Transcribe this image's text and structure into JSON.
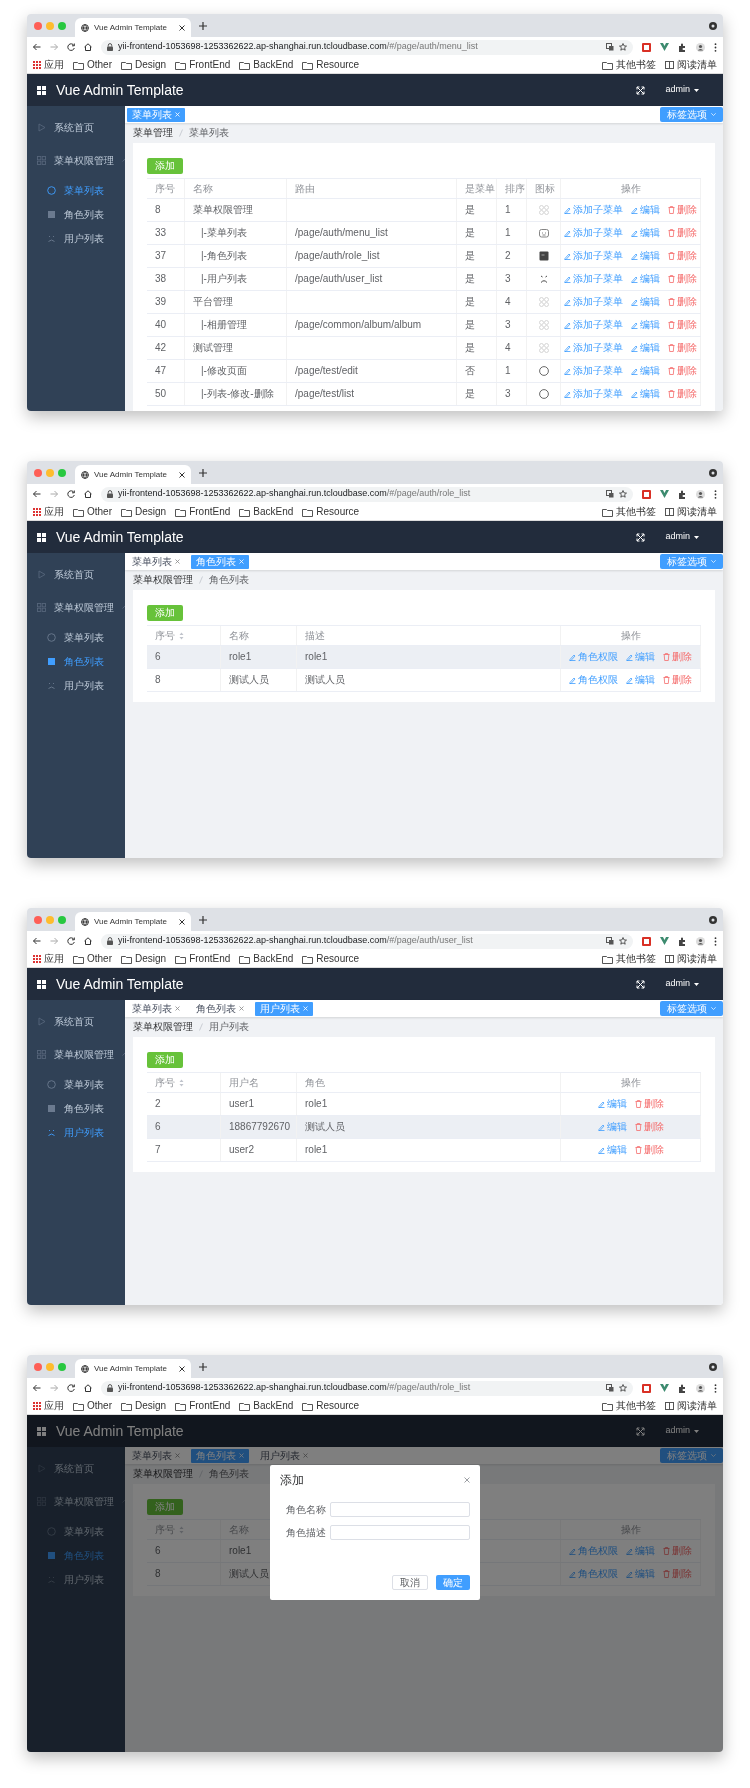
{
  "windows": [
    {
      "tab_title": "Vue Admin Template",
      "url_host": "yii-frontend-1053698-1253362622.ap-shanghai.run.tcloudbase.com",
      "url_path": "/#/page/auth/menu_list",
      "bookmarks": [
        "应用",
        "Other",
        "Design",
        "FrontEnd",
        "BackEnd",
        "Resource"
      ],
      "bookmarks_right": [
        "其他书签",
        "阅读清单"
      ],
      "app_title": "Vue Admin Template",
      "user": "admin",
      "sidebar": [
        {
          "label": "系统首页",
          "selected": false
        },
        {
          "label": "菜单权限管理",
          "expanded": true,
          "children": [
            {
              "label": "菜单列表",
              "selected": true
            },
            {
              "label": "角色列表",
              "selected": false
            },
            {
              "label": "用户列表",
              "selected": false
            }
          ]
        }
      ],
      "tags": [
        {
          "label": "菜单列表",
          "selected": true
        }
      ],
      "tags_menu": "标签选项",
      "breadcrumb": [
        "菜单管理",
        "菜单列表"
      ],
      "add_button": "添加",
      "table": {
        "kind": "menu",
        "columns": [
          {
            "label": "序号"
          },
          {
            "label": "名称"
          },
          {
            "label": "路由"
          },
          {
            "label": "是菜单"
          },
          {
            "label": "排序"
          },
          {
            "label": "图标"
          },
          {
            "label": "操作"
          }
        ],
        "rows": [
          {
            "id": "8",
            "name": "菜单权限管理",
            "is_menu": "是",
            "sort": "1",
            "actions": [
              {
                "label": "添加子菜单",
                "kind": "edit"
              },
              {
                "label": "编辑",
                "kind": "edit"
              },
              {
                "label": "删除",
                "kind": "delete"
              }
            ],
            "children": [
              {
                "id": "33",
                "name": "|-菜单列表",
                "route": "/page/auth/menu_list",
                "is_menu": "是",
                "sort": "1",
                "actions": [
                  {
                    "label": "添加子菜单",
                    "kind": "edit"
                  },
                  {
                    "label": "编辑",
                    "kind": "edit"
                  },
                  {
                    "label": "删除",
                    "kind": "delete"
                  }
                ]
              },
              {
                "id": "37",
                "name": "|-角色列表",
                "route": "/page/auth/role_list",
                "is_menu": "是",
                "sort": "2",
                "actions": [
                  {
                    "label": "添加子菜单",
                    "kind": "edit"
                  },
                  {
                    "label": "编辑",
                    "kind": "edit"
                  },
                  {
                    "label": "删除",
                    "kind": "delete"
                  }
                ]
              },
              {
                "id": "38",
                "name": "|-用户列表",
                "route": "/page/auth/user_list",
                "is_menu": "是",
                "sort": "3",
                "actions": [
                  {
                    "label": "添加子菜单",
                    "kind": "edit"
                  },
                  {
                    "label": "编辑",
                    "kind": "edit"
                  },
                  {
                    "label": "删除",
                    "kind": "delete"
                  }
                ]
              }
            ]
          },
          {
            "id": "39",
            "name": "平台管理",
            "is_menu": "是",
            "sort": "4",
            "actions": [
              {
                "label": "添加子菜单",
                "kind": "edit"
              },
              {
                "label": "编辑",
                "kind": "edit"
              },
              {
                "label": "删除",
                "kind": "delete"
              }
            ],
            "children": [
              {
                "id": "40",
                "name": "|-相册管理",
                "route": "/page/common/album/album",
                "is_menu": "是",
                "sort": "3",
                "actions": [
                  {
                    "label": "添加子菜单",
                    "kind": "edit"
                  },
                  {
                    "label": "编辑",
                    "kind": "edit"
                  },
                  {
                    "label": "删除",
                    "kind": "delete"
                  }
                ]
              }
            ]
          },
          {
            "id": "42",
            "name": "测试管理",
            "is_menu": "是",
            "sort": "4",
            "actions": [
              {
                "label": "添加子菜单",
                "kind": "edit"
              },
              {
                "label": "编辑",
                "kind": "edit"
              },
              {
                "label": "删除",
                "kind": "delete"
              }
            ],
            "children": [
              {
                "id": "47",
                "name": "|-修改页面",
                "route": "/page/test/edit",
                "is_menu": "否",
                "sort": "1",
                "actions": [
                  {
                    "label": "添加子菜单",
                    "kind": "edit"
                  },
                  {
                    "label": "编辑",
                    "kind": "edit"
                  },
                  {
                    "label": "删除",
                    "kind": "delete"
                  }
                ]
              },
              {
                "id": "50",
                "name": "|-列表-修改-删除",
                "route": "/page/test/list",
                "is_menu": "是",
                "sort": "3",
                "actions": [
                  {
                    "label": "添加子菜单",
                    "kind": "edit"
                  },
                  {
                    "label": "编辑",
                    "kind": "edit"
                  },
                  {
                    "label": "删除",
                    "kind": "delete"
                  }
                ]
              }
            ]
          }
        ]
      }
    },
    {
      "tab_title": "Vue Admin Template",
      "url_host": "yii-frontend-1053698-1253362622.ap-shanghai.run.tcloudbase.com",
      "url_path": "/#/page/auth/role_list",
      "bookmarks": [
        "应用",
        "Other",
        "Design",
        "FrontEnd",
        "BackEnd",
        "Resource"
      ],
      "bookmarks_right": [
        "其他书签",
        "阅读清单"
      ],
      "app_title": "Vue Admin Template",
      "user": "admin",
      "sidebar": [
        {
          "label": "系统首页",
          "selected": false
        },
        {
          "label": "菜单权限管理",
          "expanded": true,
          "children": [
            {
              "label": "菜单列表",
              "selected": false
            },
            {
              "label": "角色列表",
              "selected": true
            },
            {
              "label": "用户列表",
              "selected": false
            }
          ]
        }
      ],
      "tags": [
        {
          "label": "菜单列表",
          "selected": false
        },
        {
          "label": "角色列表",
          "selected": true
        }
      ],
      "tags_menu": "标签选项",
      "breadcrumb": [
        "菜单权限管理",
        "角色列表"
      ],
      "add_button": "添加",
      "table": {
        "kind": "role",
        "columns": [
          {
            "label": "序号",
            "sortable": true
          },
          {
            "label": "名称",
            "sortable": false
          },
          {
            "label": "描述",
            "sortable": false
          },
          {
            "label": "操作",
            "sortable": false
          }
        ],
        "rows": [
          {
            "id": "6",
            "name": "role1",
            "description": "role1",
            "hovered": true,
            "actions": [
              {
                "label": "角色权限",
                "kind": "edit"
              },
              {
                "label": "编辑",
                "kind": "edit"
              },
              {
                "label": "删除",
                "kind": "delete"
              }
            ]
          },
          {
            "id": "8",
            "name": "测试人员",
            "description": "测试人员",
            "hovered": false,
            "actions": [
              {
                "label": "角色权限",
                "kind": "edit"
              },
              {
                "label": "编辑",
                "kind": "edit"
              },
              {
                "label": "删除",
                "kind": "delete"
              }
            ]
          }
        ]
      }
    },
    {
      "tab_title": "Vue Admin Template",
      "url_host": "yii-frontend-1053698-1253362622.ap-shanghai.run.tcloudbase.com",
      "url_path": "/#/page/auth/user_list",
      "bookmarks": [
        "应用",
        "Other",
        "Design",
        "FrontEnd",
        "BackEnd",
        "Resource"
      ],
      "bookmarks_right": [
        "其他书签",
        "阅读清单"
      ],
      "app_title": "Vue Admin Template",
      "user": "admin",
      "sidebar": [
        {
          "label": "系统首页",
          "selected": false
        },
        {
          "label": "菜单权限管理",
          "expanded": true,
          "children": [
            {
              "label": "菜单列表",
              "selected": false
            },
            {
              "label": "角色列表",
              "selected": false
            },
            {
              "label": "用户列表",
              "selected": true
            }
          ]
        }
      ],
      "tags": [
        {
          "label": "菜单列表",
          "selected": false
        },
        {
          "label": "角色列表",
          "selected": false
        },
        {
          "label": "用户列表",
          "selected": true
        }
      ],
      "tags_menu": "标签选项",
      "breadcrumb": [
        "菜单权限管理",
        "用户列表"
      ],
      "add_button": "添加",
      "table": {
        "kind": "user",
        "columns": [
          {
            "label": "序号",
            "sortable": true
          },
          {
            "label": "用户名",
            "sortable": false
          },
          {
            "label": "角色",
            "sortable": false
          },
          {
            "label": "操作",
            "sortable": false
          }
        ],
        "rows": [
          {
            "id": "2",
            "name": "user1",
            "role": "role1",
            "hovered": false,
            "actions": [
              {
                "label": "编辑",
                "kind": "edit"
              },
              {
                "label": "删除",
                "kind": "delete"
              }
            ]
          },
          {
            "id": "6",
            "name": "18867792670",
            "role": "测试人员",
            "hovered": true,
            "actions": [
              {
                "label": "编辑",
                "kind": "edit"
              },
              {
                "label": "删除",
                "kind": "delete"
              }
            ]
          },
          {
            "id": "7",
            "name": "user2",
            "role": "role1",
            "hovered": false,
            "actions": [
              {
                "label": "编辑",
                "kind": "edit"
              },
              {
                "label": "删除",
                "kind": "delete"
              }
            ]
          }
        ]
      }
    },
    {
      "tab_title": "Vue Admin Template",
      "url_host": "yii-frontend-1053698-1253362622.ap-shanghai.run.tcloudbase.com",
      "url_path": "/#/page/auth/role_list",
      "bookmarks": [
        "应用",
        "Other",
        "Design",
        "FrontEnd",
        "BackEnd",
        "Resource"
      ],
      "bookmarks_right": [
        "其他书签",
        "阅读清单"
      ],
      "app_title": "Vue Admin Template",
      "user": "admin",
      "sidebar": [
        {
          "label": "系统首页",
          "selected": false
        },
        {
          "label": "菜单权限管理",
          "expanded": true,
          "children": [
            {
              "label": "菜单列表",
              "selected": false
            },
            {
              "label": "角色列表",
              "selected": true
            },
            {
              "label": "用户列表",
              "selected": false
            }
          ]
        }
      ],
      "tags": [
        {
          "label": "菜单列表",
          "selected": false
        },
        {
          "label": "角色列表",
          "selected": true
        },
        {
          "label": "用户列表",
          "selected": false
        }
      ],
      "tags_menu": "标签选项",
      "breadcrumb": [
        "菜单权限管理",
        "角色列表"
      ],
      "add_button": "添加",
      "table": {
        "kind": "role_covered",
        "columns": [
          {
            "label": "序号",
            "sortable": true
          },
          {
            "label": "名称",
            "sortable": false
          },
          {
            "label": "操作",
            "sortable": false
          }
        ],
        "rows": [
          {
            "id": "6",
            "name": "role1",
            "actions": [
              {
                "label": "角色权限",
                "kind": "edit"
              },
              {
                "label": "编辑",
                "kind": "edit"
              },
              {
                "label": "删除",
                "kind": "delete"
              }
            ]
          },
          {
            "id": "8",
            "name": "测试人员",
            "actions": [
              {
                "label": "角色权限",
                "kind": "edit"
              },
              {
                "label": "编辑",
                "kind": "edit"
              },
              {
                "label": "删除",
                "kind": "delete"
              }
            ]
          }
        ]
      },
      "dialog": {
        "title": "添加",
        "fields": [
          {
            "label": "角色名称"
          },
          {
            "label": "角色描述"
          }
        ],
        "buttons": [
          {
            "label": "取消",
            "kind": "default"
          },
          {
            "label": "确定",
            "kind": "primary"
          }
        ]
      }
    }
  ]
}
